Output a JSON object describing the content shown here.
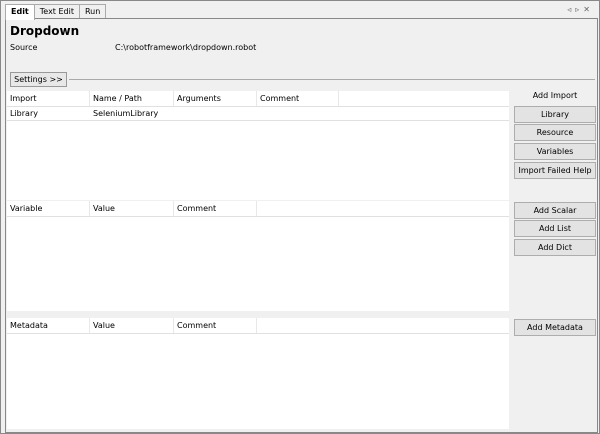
{
  "tabs": [
    "Edit",
    "Text Edit",
    "Run"
  ],
  "nav": {
    "prev_icon": "triangle-left-icon",
    "next_icon": "triangle-right-icon",
    "close_icon": "close-icon"
  },
  "title": "Dropdown",
  "source": {
    "label": "Source",
    "value": "C:\\robotframework\\dropdown.robot"
  },
  "settings_button": "Settings >>",
  "imports": {
    "columns": [
      "Import",
      "Name / Path",
      "Arguments",
      "Comment"
    ],
    "rows": [
      [
        "Library",
        "SeleniumLibrary",
        "",
        ""
      ]
    ],
    "heading": "Add Import",
    "buttons": [
      "Library",
      "Resource",
      "Variables",
      "Import Failed Help"
    ]
  },
  "variables": {
    "columns": [
      "Variable",
      "Value",
      "Comment"
    ],
    "buttons": [
      "Add Scalar",
      "Add List",
      "Add Dict"
    ]
  },
  "metadata": {
    "columns": [
      "Metadata",
      "Value",
      "Comment"
    ],
    "buttons": [
      "Add Metadata"
    ]
  }
}
